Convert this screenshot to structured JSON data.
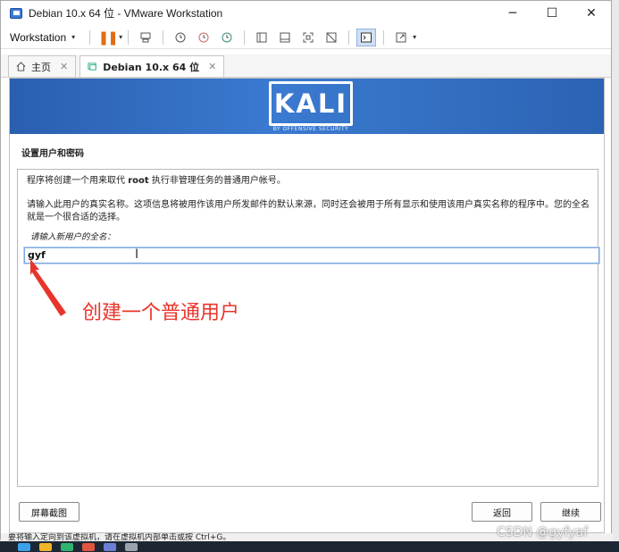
{
  "window": {
    "title": "Debian 10.x 64 位 - VMware Workstation"
  },
  "window_controls": {
    "minimize": "─",
    "maximize": "☐",
    "close": "✕"
  },
  "toolbar": {
    "menu_label": "Workstation",
    "caret": "▾",
    "pause": "❚❚"
  },
  "tabs": [
    {
      "label": "主页",
      "close": "✕"
    },
    {
      "label": "Debian 10.x 64 位",
      "close": "✕"
    }
  ],
  "installer": {
    "logo_text": "KALI",
    "logo_subtitle": "BY OFFENSIVE SECURITY",
    "section_title": "设置用户和密码",
    "intro_pre": "程序将创建一个用来取代",
    "intro_root": "root",
    "intro_post": "执行非管理任务的普通用户帐号。",
    "description": "请输入此用户的真实名称。这项信息将被用作该用户所发邮件的默认来源，同时还会被用于所有显示和使用该用户真实名称的程序中。您的全名就是一个很合适的选择。",
    "field_label": "请输入新用户的全名：",
    "field_value": "gyf",
    "screenshot_button": "屏幕截图",
    "back_button": "返回",
    "continue_button": "继续"
  },
  "annotation": {
    "text": "创建一个普通用户",
    "color": "#e8352b"
  },
  "statusbar": {
    "text": "要将输入定向到该虚拟机，请在虚拟机内部单击或按 Ctrl+G。"
  },
  "watermark": {
    "text": "CSDN @gyfyaf"
  },
  "colors": {
    "banner": "#2f6cc0",
    "accent": "#7aa7e0"
  }
}
